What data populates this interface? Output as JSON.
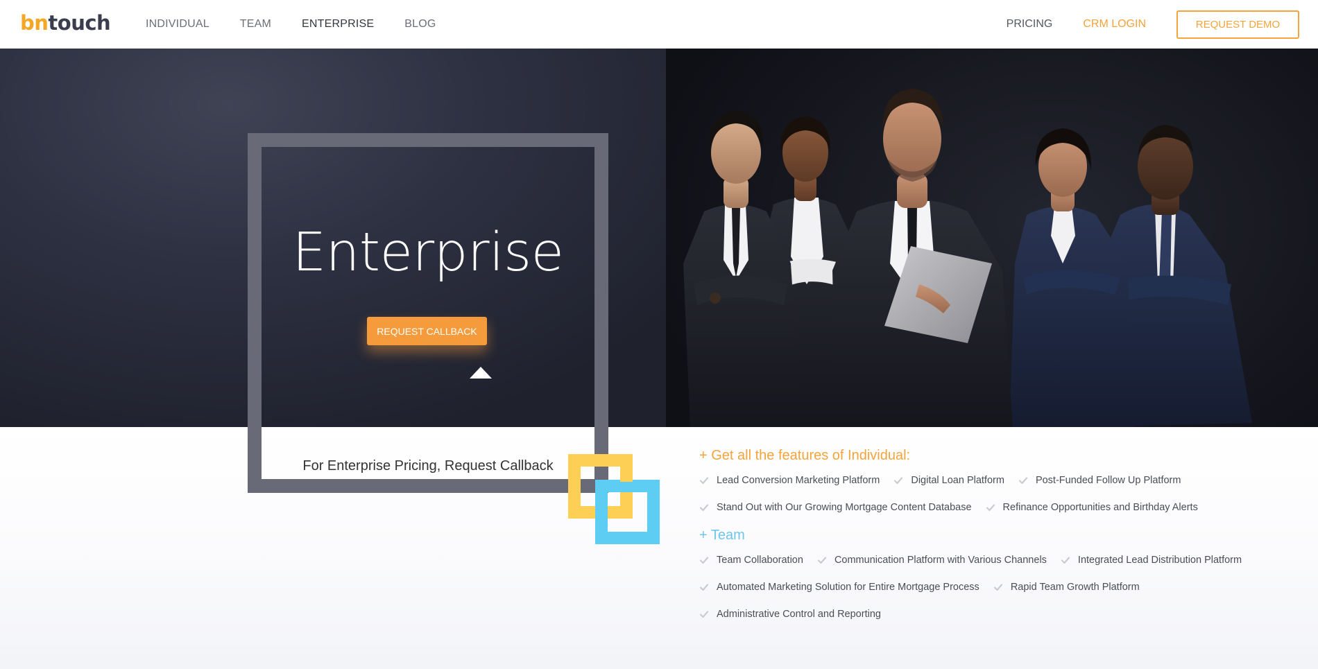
{
  "brand": {
    "logo_part1": "bn",
    "logo_part2": "touch"
  },
  "nav": {
    "links": [
      "INDIVIDUAL",
      "TEAM",
      "ENTERPRISE",
      "BLOG"
    ],
    "pricing": "PRICING",
    "login": "CRM LOGIN",
    "demo": "REQUEST DEMO"
  },
  "hero": {
    "title": "Enterprise",
    "cta": "REQUEST CALLBACK",
    "subtitle": "For Enterprise Pricing, Request Callback"
  },
  "features": {
    "individual_heading": "+ Get all the features of Individual:",
    "individual_items": [
      "Lead Conversion Marketing Platform",
      "Digital Loan Platform",
      "Post-Funded Follow Up Platform",
      "Stand Out with Our Growing Mortgage Content Database",
      "Refinance Opportunities and Birthday Alerts"
    ],
    "team_heading": "+ Team",
    "team_items": [
      "Team Collaboration",
      "Communication Platform with Various Channels",
      "Integrated Lead Distribution Platform",
      "Automated Marketing Solution for Entire Mortgage Process",
      "Rapid Team Growth Platform",
      "Administrative Control and Reporting"
    ]
  },
  "colors": {
    "accent_orange": "#f5a33a",
    "accent_blue": "#6dc5ec",
    "square_yellow": "#fdd055",
    "square_blue": "#5ecdf4",
    "frame_gray": "#686b77"
  }
}
